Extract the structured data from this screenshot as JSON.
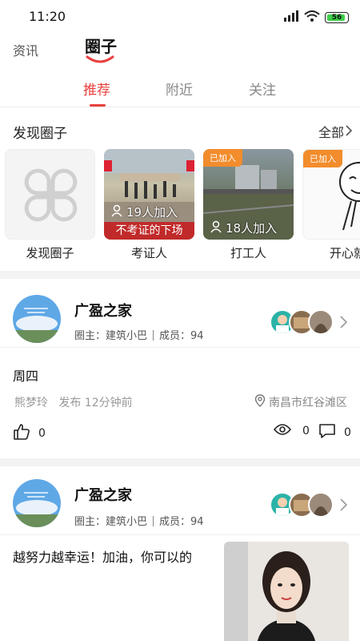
{
  "status": {
    "time": "11:20",
    "battery": "56"
  },
  "top_tabs": {
    "news": "资讯",
    "circle": "圈子"
  },
  "sub_tabs": [
    {
      "label": "推荐",
      "active": true
    },
    {
      "label": "附近",
      "active": false
    },
    {
      "label": "关注",
      "active": false
    }
  ],
  "discover": {
    "title": "发现圈子",
    "all_label": "全部",
    "circles": [
      {
        "name": "发现圈子",
        "thumb": "clover-icon"
      },
      {
        "name": "考证人",
        "caption": "不考证的下场",
        "join_count": "19人加入"
      },
      {
        "name": "打工人",
        "tag": "已加入",
        "join_count": "18人加入"
      },
      {
        "name": "开心就",
        "tag": "已加入"
      }
    ]
  },
  "posts": [
    {
      "circle_name": "广盈之家",
      "owner": "圈主：建筑小巴",
      "members": "成员：94",
      "content": "周四",
      "author": "熊梦玲",
      "published": "发布 12分钟前",
      "location": "南昌市红谷滩区",
      "likes": "0",
      "views": "0",
      "comments": "0"
    },
    {
      "circle_name": "广盈之家",
      "owner": "圈主：建筑小巴",
      "members": "成员：94",
      "content": "越努力越幸运！加油，你可以的"
    }
  ],
  "colors": {
    "accent": "#e8413e",
    "joined_tag": "#f28c2c"
  }
}
